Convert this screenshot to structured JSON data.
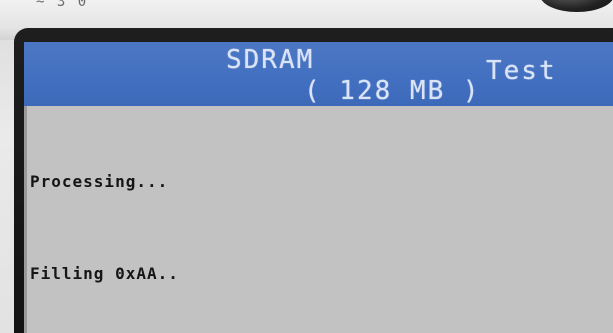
{
  "device": {
    "case_marking": "~ 3 0"
  },
  "screen": {
    "header": {
      "title_part1": "SDRAM",
      "title_part2": "Test",
      "memory_size": "( 128 MB )"
    },
    "console_lines": [
      "Processing...",
      "Filling 0xAA.."
    ]
  },
  "colors": {
    "header_blue": "#4a74c2",
    "header_text": "#dbe4f6",
    "screen_gray": "#c2c2c2",
    "console_text": "#151515"
  }
}
